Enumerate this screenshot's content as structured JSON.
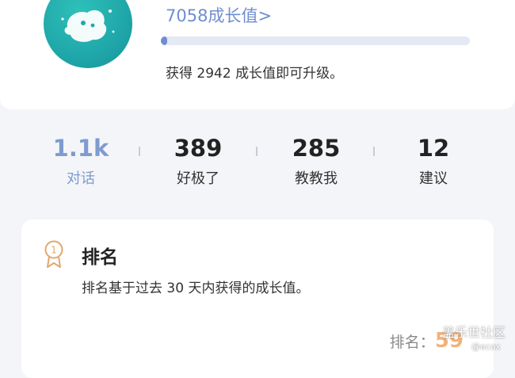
{
  "profile": {
    "growth_value": "7058成长值",
    "chevron": ">",
    "growth_progress": 0.02,
    "upgrade_text": "获得 2942 成长值即可升级。"
  },
  "stats": [
    {
      "value": "1.1k",
      "label": "对话",
      "active": true
    },
    {
      "value": "389",
      "label": "好极了",
      "active": false
    },
    {
      "value": "285",
      "label": "教教我",
      "active": false
    },
    {
      "value": "12",
      "label": "建议",
      "active": false
    }
  ],
  "ranking": {
    "title": "排名",
    "description": "排名基于过去 30 天内获得的成长值。",
    "rank_label": "排名：",
    "rank_value": "59"
  },
  "watermark": {
    "site": "盖乐世社区",
    "handle": "@ecox"
  },
  "colors": {
    "accent": "#6f8ed0",
    "rank_orange": "#f1b27a",
    "avatar_teal": "#20a9aa"
  }
}
